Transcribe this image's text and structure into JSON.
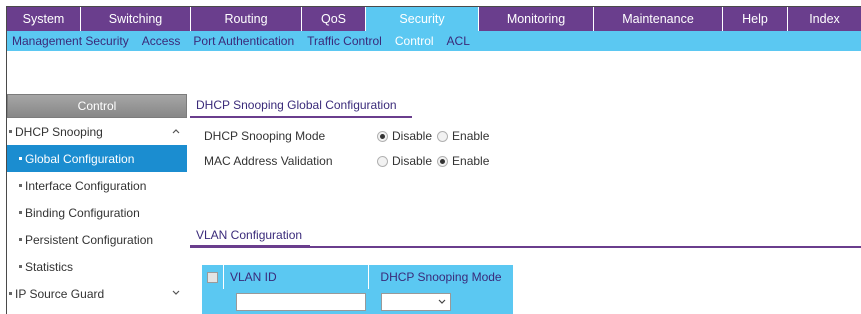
{
  "topnav": {
    "tabs": [
      {
        "label": "System",
        "width": 74
      },
      {
        "label": "Switching",
        "width": 110
      },
      {
        "label": "Routing",
        "width": 111
      },
      {
        "label": "QoS",
        "width": 64
      },
      {
        "label": "Security",
        "width": 113,
        "active": true
      },
      {
        "label": "Monitoring",
        "width": 115
      },
      {
        "label": "Maintenance",
        "width": 129
      },
      {
        "label": "Help",
        "width": 65
      },
      {
        "label": "Index",
        "width": 74
      }
    ]
  },
  "subnav": {
    "items": [
      {
        "label": "Management Security"
      },
      {
        "label": "Access"
      },
      {
        "label": "Port Authentication"
      },
      {
        "label": "Traffic Control"
      },
      {
        "label": "Control",
        "active": true
      },
      {
        "label": "ACL"
      }
    ]
  },
  "leftpanel": {
    "header": "Control",
    "items": [
      {
        "label": "DHCP Snooping",
        "level": "top",
        "chevron": "up"
      },
      {
        "label": "Global Configuration",
        "level": "sub",
        "selected": true
      },
      {
        "label": "Interface Configuration",
        "level": "sub"
      },
      {
        "label": "Binding Configuration",
        "level": "sub"
      },
      {
        "label": "Persistent Configuration",
        "level": "sub"
      },
      {
        "label": "Statistics",
        "level": "sub"
      },
      {
        "label": "IP Source Guard",
        "level": "top",
        "chevron": "down"
      }
    ]
  },
  "global_config": {
    "title": "DHCP Snooping Global Configuration",
    "mode_label": "DHCP Snooping Mode",
    "mode_options": [
      "Disable",
      "Enable"
    ],
    "mode_selected": "Disable",
    "mac_label": "MAC Address Validation",
    "mac_options": [
      "Disable",
      "Enable"
    ],
    "mac_selected": "Enable"
  },
  "vlan_config": {
    "title": "VLAN Configuration",
    "columns": [
      "VLAN ID",
      "DHCP Snooping Mode"
    ],
    "vlan_id_value": "",
    "mode_value": ""
  },
  "colors": {
    "nav_purple": "#6a3e8d",
    "nav_blue": "#5bc8f2",
    "selected_blue": "#1b8dd0"
  }
}
